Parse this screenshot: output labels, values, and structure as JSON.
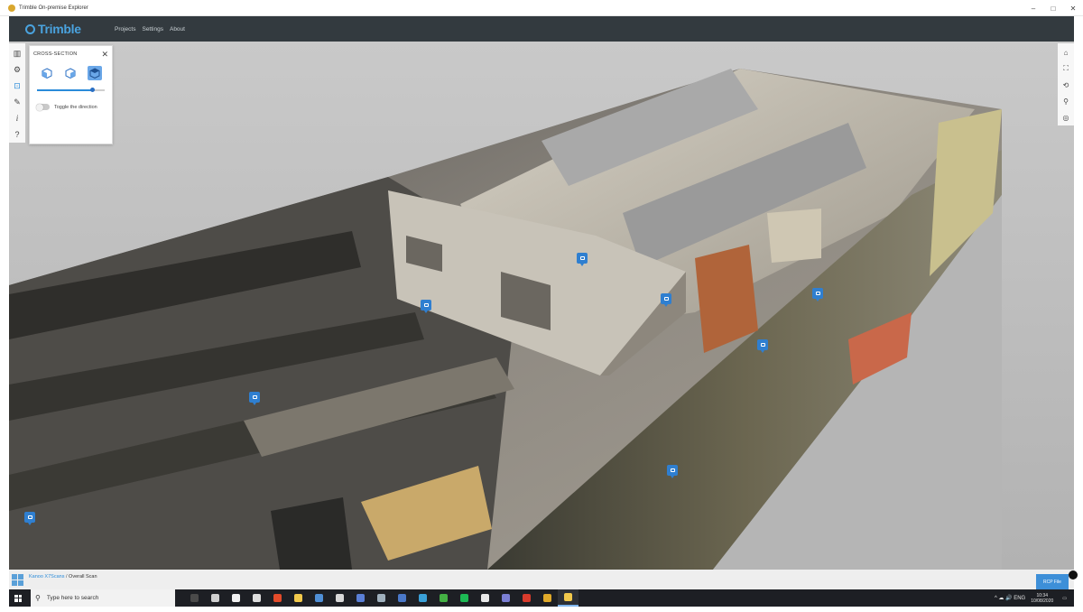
{
  "window": {
    "title": "Trimble On-premise Explorer",
    "controls": [
      "–",
      "□",
      "✕"
    ]
  },
  "header": {
    "brand": "Trimble",
    "nav": [
      "Projects",
      "Settings",
      "About"
    ]
  },
  "left_toolbar": [
    {
      "icon": "map-icon",
      "glyph": "▥"
    },
    {
      "icon": "gear-icon",
      "glyph": "⚙"
    },
    {
      "icon": "crop-icon",
      "glyph": "⊡"
    },
    {
      "icon": "ruler-icon",
      "glyph": "✎"
    },
    {
      "icon": "info-icon",
      "glyph": "i"
    },
    {
      "icon": "help-icon",
      "glyph": "?"
    }
  ],
  "cross_section": {
    "title": "CROSS-SECTION",
    "close": "✕",
    "slider_value": 0.82,
    "toggle_label": "Toggle the direction",
    "toggle_on": false
  },
  "right_toolbar": [
    {
      "icon": "home-icon",
      "glyph": "⌂"
    },
    {
      "icon": "fullscreen-icon",
      "glyph": "⛶"
    },
    {
      "icon": "rotate-icon",
      "glyph": "⟲"
    },
    {
      "icon": "walk-icon",
      "glyph": "⚲"
    },
    {
      "icon": "compass-icon",
      "glyph": "◎"
    }
  ],
  "breadcrumb": {
    "link": "Kanoo X7Scans",
    "sep": " / ",
    "current": "Overall Scan"
  },
  "rcp_button": "RCP File",
  "taskbar": {
    "search_placeholder": "Type here to search",
    "apps": [
      "#4a4a4a",
      "#cfcfcf",
      "#f1f1f1",
      "#dddddd",
      "#e34b2a",
      "#f2c94c",
      "#4f8fd6",
      "#d8d8d8",
      "#5a7fd6",
      "#9fb0bd",
      "#4a78c8",
      "#3aa0d8",
      "#44b044",
      "#1db954",
      "#e8e8e8",
      "#7b7fd4",
      "#d93b2c",
      "#e0a92a",
      "#f2c94c"
    ],
    "tray_icons": "^ ☁ 🔊 ENG",
    "time": "10:34",
    "date": "10/08/2020"
  },
  "colors": {
    "accent": "#2a8bd9",
    "header": "#333a3f",
    "camera_marker": "#2f7fd0"
  }
}
